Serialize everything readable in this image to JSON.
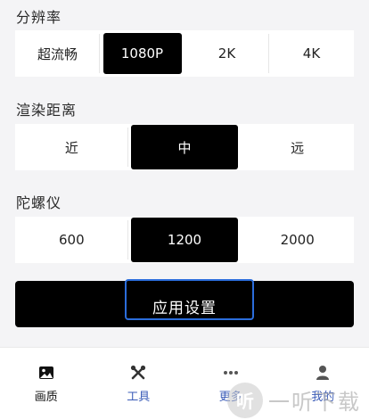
{
  "sections": {
    "resolution": {
      "title": "分辨率",
      "options": [
        "超流畅",
        "1080P",
        "2K",
        "4K"
      ],
      "selected_index": 1
    },
    "render_distance": {
      "title": "渲染距离",
      "options": [
        "近",
        "中",
        "远"
      ],
      "selected_index": 1
    },
    "gyroscope": {
      "title": "陀螺仪",
      "options": [
        "600",
        "1200",
        "2000"
      ],
      "selected_index": 1
    }
  },
  "apply_button": {
    "label": "应用设置"
  },
  "tabbar": {
    "tabs": [
      {
        "label": "画质",
        "icon": "image-icon",
        "active": true
      },
      {
        "label": "工具",
        "icon": "tools-icon",
        "active": false
      },
      {
        "label": "更多",
        "icon": "more-dots-icon",
        "active": false
      },
      {
        "label": "我的",
        "icon": "user-icon",
        "active": false
      }
    ]
  },
  "watermark": {
    "glyph": "听",
    "text": "一听下载"
  },
  "colors": {
    "accent_focus": "#2b6ddb",
    "selected_bg": "#000000",
    "tab_label": "#3b5cb8"
  }
}
